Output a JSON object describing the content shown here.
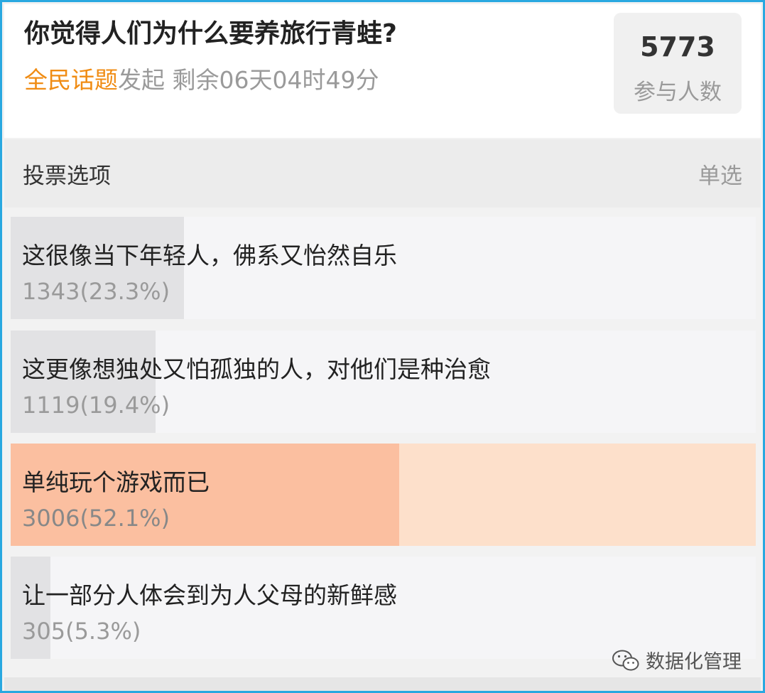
{
  "poll": {
    "question": "你觉得人们为什么要养旅行青蛙?",
    "initiator": "全民话题",
    "initiated_text": "发起",
    "remaining": "剩余06天04时49分",
    "participants": {
      "count": "5773",
      "label": "参与人数"
    }
  },
  "section": {
    "title": "投票选项",
    "mode": "单选"
  },
  "options": [
    {
      "label": "这很像当下年轻人，佛系又怡然自乐",
      "result": "1343(23.3%)",
      "votes": 1343,
      "percent": 23.3,
      "selected": false
    },
    {
      "label": "这更像想独处又怕孤独的人，对他们是种治愈",
      "result": "1119(19.4%)",
      "votes": 1119,
      "percent": 19.4,
      "selected": false
    },
    {
      "label": "单纯玩个游戏而已",
      "result": "3006(52.1%)",
      "votes": 3006,
      "percent": 52.1,
      "selected": true
    },
    {
      "label": "让一部分人体会到为人父母的新鲜感",
      "result": "305(5.3%)",
      "votes": 305,
      "percent": 5.3,
      "selected": false
    }
  ],
  "watermark": {
    "icon": "wechat-icon",
    "text": "数据化管理"
  },
  "colors": {
    "frame_border": "#29a8e0",
    "accent_topic": "#f08c14",
    "selected_fill": "#fbbfa0",
    "selected_bg": "#fde0cb",
    "option_fill": "#e2e2e4"
  }
}
